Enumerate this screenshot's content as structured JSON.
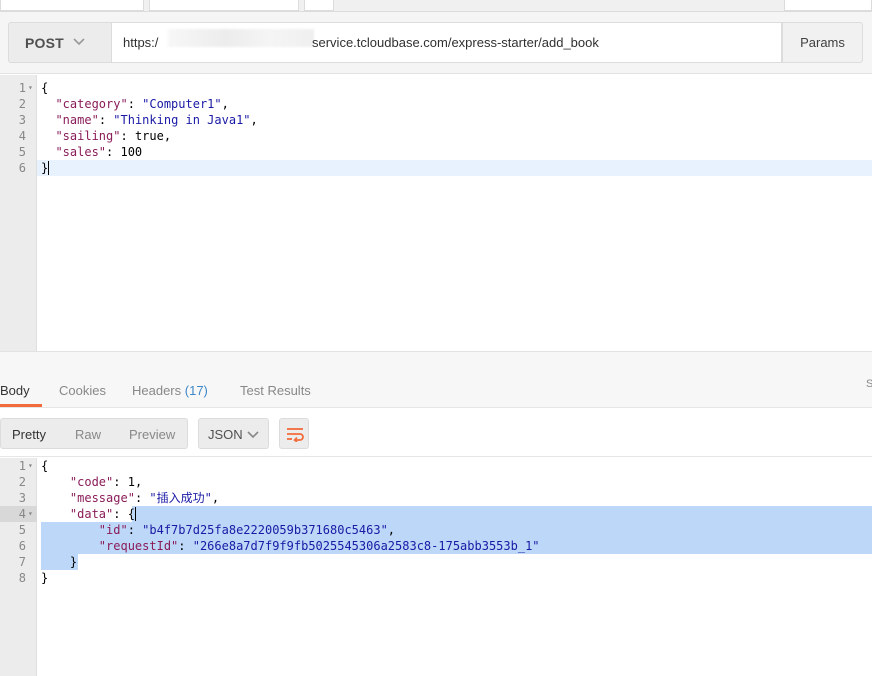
{
  "request": {
    "method": "POST",
    "url_prefix": "https:/",
    "url_suffix": "service.tcloudbase.com/express-starter/add_book",
    "params_label": "Params"
  },
  "request_body": {
    "lines": [
      {
        "n": "1",
        "fold": "▾",
        "parts": [
          [
            "p",
            "{"
          ]
        ]
      },
      {
        "n": "2",
        "fold": "",
        "parts": [
          [
            "p",
            "  "
          ],
          [
            "k",
            "\"category\""
          ],
          [
            "p",
            ": "
          ],
          [
            "s",
            "\"Computer1\""
          ],
          [
            "p",
            ","
          ]
        ]
      },
      {
        "n": "3",
        "fold": "",
        "parts": [
          [
            "p",
            "  "
          ],
          [
            "k",
            "\"name\""
          ],
          [
            "p",
            ": "
          ],
          [
            "s",
            "\"Thinking in Java1\""
          ],
          [
            "p",
            ","
          ]
        ]
      },
      {
        "n": "4",
        "fold": "",
        "parts": [
          [
            "p",
            "  "
          ],
          [
            "k",
            "\"sailing\""
          ],
          [
            "p",
            ": "
          ],
          [
            "p",
            "true"
          ],
          [
            "p",
            ","
          ]
        ]
      },
      {
        "n": "5",
        "fold": "",
        "parts": [
          [
            "p",
            "  "
          ],
          [
            "k",
            "\"sales\""
          ],
          [
            "p",
            ": "
          ],
          [
            "p",
            "100"
          ]
        ]
      },
      {
        "n": "6",
        "fold": "",
        "parts": [
          [
            "p",
            "}"
          ]
        ]
      }
    ]
  },
  "response_tabs": {
    "body": "Body",
    "cookies": "Cookies",
    "headers": "Headers",
    "headers_count": "(17)",
    "test_results": "Test Results",
    "edge_char": "S"
  },
  "view_modes": {
    "pretty": "Pretty",
    "raw": "Raw",
    "preview": "Preview",
    "format": "JSON"
  },
  "response_body": {
    "lines": [
      {
        "n": "1",
        "fold": "▾",
        "parts": [
          [
            "p",
            "{"
          ]
        ]
      },
      {
        "n": "2",
        "fold": "",
        "parts": [
          [
            "p",
            "    "
          ],
          [
            "k",
            "\"code\""
          ],
          [
            "p",
            ": 1,"
          ]
        ]
      },
      {
        "n": "3",
        "fold": "",
        "parts": [
          [
            "p",
            "    "
          ],
          [
            "k",
            "\"message\""
          ],
          [
            "p",
            ": "
          ],
          [
            "s",
            "\"插入成功\""
          ],
          [
            "p",
            ","
          ]
        ]
      },
      {
        "n": "4",
        "fold": "▾",
        "parts": [
          [
            "p",
            "    "
          ],
          [
            "k",
            "\"data\""
          ],
          [
            "p",
            ": {"
          ]
        ]
      },
      {
        "n": "5",
        "fold": "",
        "parts": [
          [
            "p",
            "        "
          ],
          [
            "k",
            "\"id\""
          ],
          [
            "p",
            ": "
          ],
          [
            "s",
            "\"b4f7b7d25fa8e2220059b371680c5463\""
          ],
          [
            "p",
            ","
          ]
        ]
      },
      {
        "n": "6",
        "fold": "",
        "parts": [
          [
            "p",
            "        "
          ],
          [
            "k",
            "\"requestId\""
          ],
          [
            "p",
            ": "
          ],
          [
            "s",
            "\"266e8a7d7f9f9fb5025545306a2583c8-175abb3553b_1\""
          ]
        ]
      },
      {
        "n": "7",
        "fold": "",
        "parts": [
          [
            "p",
            "    }"
          ]
        ]
      },
      {
        "n": "8",
        "fold": "",
        "parts": [
          [
            "p",
            "}"
          ]
        ]
      }
    ]
  }
}
